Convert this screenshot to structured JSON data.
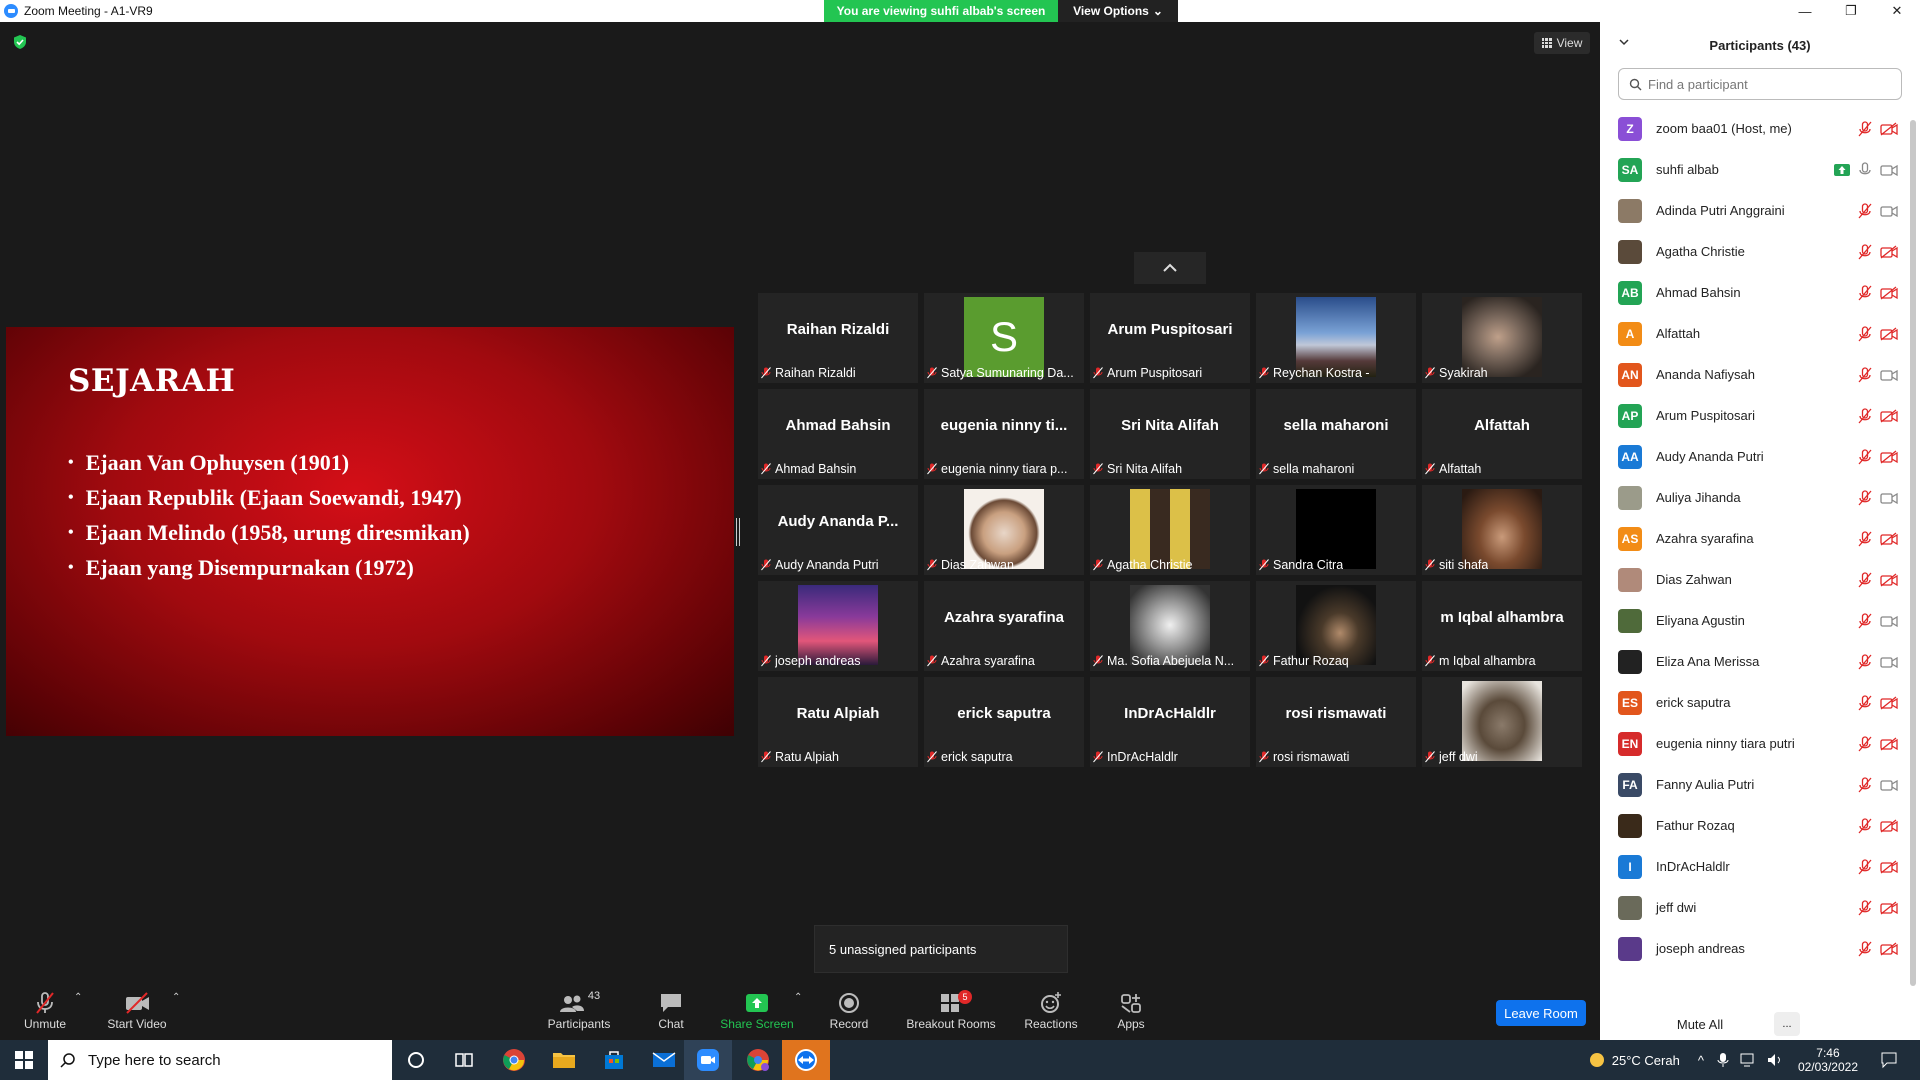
{
  "window": {
    "title": "Zoom Meeting - A1-VR9",
    "viewing_banner": "You are viewing suhfi albab's screen",
    "view_options": "View Options",
    "view_button": "View"
  },
  "slide": {
    "title": "SEJARAH",
    "bullets": [
      "Ejaan Van Ophuysen (1901)",
      "Ejaan Republik (Ejaan Soewandi, 1947)",
      "Ejaan Melindo (1958, urung diresmikan)",
      "Ejaan yang Disempurnakan (1972)"
    ]
  },
  "tiles": [
    {
      "big": "Raihan Rizaldi",
      "caption": "Raihan Rizaldi",
      "thumb": "none"
    },
    {
      "big": "",
      "caption": "Satya Sumunaring Da...",
      "thumb": "letter",
      "letter": "S"
    },
    {
      "big": "Arum Puspitosari",
      "caption": "Arum Puspitosari",
      "thumb": "none"
    },
    {
      "big": "",
      "caption": "Reychan Kostra -",
      "thumb": "sky"
    },
    {
      "big": "",
      "caption": "Syakirah",
      "thumb": "hand"
    },
    {
      "big": "Ahmad Bahsin",
      "caption": "Ahmad Bahsin",
      "thumb": "none"
    },
    {
      "big": "eugenia ninny ti...",
      "caption": "eugenia ninny tiara p...",
      "thumb": "none"
    },
    {
      "big": "Sri Nita Alifah",
      "caption": "Sri Nita Alifah",
      "thumb": "none"
    },
    {
      "big": "sella maharoni",
      "caption": "sella maharoni",
      "thumb": "none"
    },
    {
      "big": "Alfattah",
      "caption": "Alfattah",
      "thumb": "none"
    },
    {
      "big": "Audy Ananda P...",
      "caption": "Audy Ananda Putri",
      "thumb": "none"
    },
    {
      "big": "",
      "caption": "Dias Zahwan",
      "thumb": "cartoon"
    },
    {
      "big": "",
      "caption": "Agatha Christie",
      "thumb": "collage"
    },
    {
      "big": "",
      "caption": "Sandra Citra",
      "thumb": "black"
    },
    {
      "big": "",
      "caption": "siti shafa",
      "thumb": "group"
    },
    {
      "big": "",
      "caption": "joseph andreas",
      "thumb": "sunset"
    },
    {
      "big": "Azahra syarafina",
      "caption": "Azahra syarafina",
      "thumb": "none"
    },
    {
      "big": "",
      "caption": "Ma. Sofia Abejuela N...",
      "thumb": "flower"
    },
    {
      "big": "",
      "caption": "Fathur Rozaq",
      "thumb": "dark"
    },
    {
      "big": "m Iqbal alhambra",
      "caption": "m Iqbal alhambra",
      "thumb": "none"
    },
    {
      "big": "Ratu Alpiah",
      "caption": "Ratu Alpiah",
      "thumb": "none"
    },
    {
      "big": "erick saputra",
      "caption": "erick saputra",
      "thumb": "none"
    },
    {
      "big": "InDrAcHaldlr",
      "caption": "InDrAcHaldlr",
      "thumb": "none"
    },
    {
      "big": "rosi rismawati",
      "caption": "rosi rismawati",
      "thumb": "none"
    },
    {
      "big": "",
      "caption": "jeff dwi",
      "thumb": "guitar"
    }
  ],
  "unassigned": "5 unassigned participants",
  "toolbar": {
    "unmute": "Unmute",
    "start_video": "Start Video",
    "participants": "Participants",
    "participants_count": "43",
    "chat": "Chat",
    "share_screen": "Share Screen",
    "record": "Record",
    "breakout_rooms": "Breakout Rooms",
    "breakout_badge": "5",
    "reactions": "Reactions",
    "apps": "Apps",
    "leave_room": "Leave Room"
  },
  "panel": {
    "title": "Participants (43)",
    "search_placeholder": "Find a participant",
    "mute_all": "Mute All",
    "more": "...",
    "participants": [
      {
        "initials": "Z",
        "color": "#8a4fd6",
        "name": "zoom baa01 (Host, me)",
        "video": "off"
      },
      {
        "initials": "SA",
        "color": "#23a455",
        "name": "suhfi albab",
        "video": "on",
        "sharing": true
      },
      {
        "initials": "",
        "color": "#8c7a66",
        "name": "Adinda Putri Anggraini",
        "video": "on"
      },
      {
        "initials": "",
        "color": "#5a4a3a",
        "name": "Agatha Christie",
        "video": "off"
      },
      {
        "initials": "AB",
        "color": "#23a455",
        "name": "Ahmad Bahsin",
        "video": "off"
      },
      {
        "initials": "A",
        "color": "#f28c16",
        "name": "Alfattah",
        "video": "off"
      },
      {
        "initials": "AN",
        "color": "#e2561c",
        "name": "Ananda Nafiysah",
        "video": "on"
      },
      {
        "initials": "AP",
        "color": "#23a455",
        "name": "Arum Puspitosari",
        "video": "off"
      },
      {
        "initials": "AA",
        "color": "#1a7ad6",
        "name": "Audy Ananda Putri",
        "video": "off"
      },
      {
        "initials": "",
        "color": "#9b9b8a",
        "name": "Auliya Jihanda",
        "video": "on"
      },
      {
        "initials": "AS",
        "color": "#f28c16",
        "name": "Azahra syarafina",
        "video": "off"
      },
      {
        "initials": "",
        "color": "#b08a7a",
        "name": "Dias Zahwan",
        "video": "off"
      },
      {
        "initials": "",
        "color": "#4f6a3a",
        "name": "Eliyana Agustin",
        "video": "on"
      },
      {
        "initials": "",
        "color": "#222222",
        "name": "Eliza Ana Merissa",
        "video": "on"
      },
      {
        "initials": "ES",
        "color": "#e2561c",
        "name": "erick saputra",
        "video": "off"
      },
      {
        "initials": "EN",
        "color": "#d62b2b",
        "name": "eugenia ninny tiara putri",
        "video": "off"
      },
      {
        "initials": "FA",
        "color": "#3a4a66",
        "name": "Fanny Aulia Putri",
        "video": "on"
      },
      {
        "initials": "",
        "color": "#3a2a1a",
        "name": "Fathur Rozaq",
        "video": "off"
      },
      {
        "initials": "I",
        "color": "#1a7ad6",
        "name": "InDrAcHaldlr",
        "video": "off"
      },
      {
        "initials": "",
        "color": "#6a6a5a",
        "name": "jeff dwi",
        "video": "off"
      },
      {
        "initials": "",
        "color": "#5a3a8a",
        "name": "joseph andreas",
        "video": "off"
      }
    ]
  },
  "taskbar": {
    "search_placeholder": "Type here to search",
    "weather": "25°C  Cerah",
    "time": "7:46",
    "date": "02/03/2022"
  }
}
